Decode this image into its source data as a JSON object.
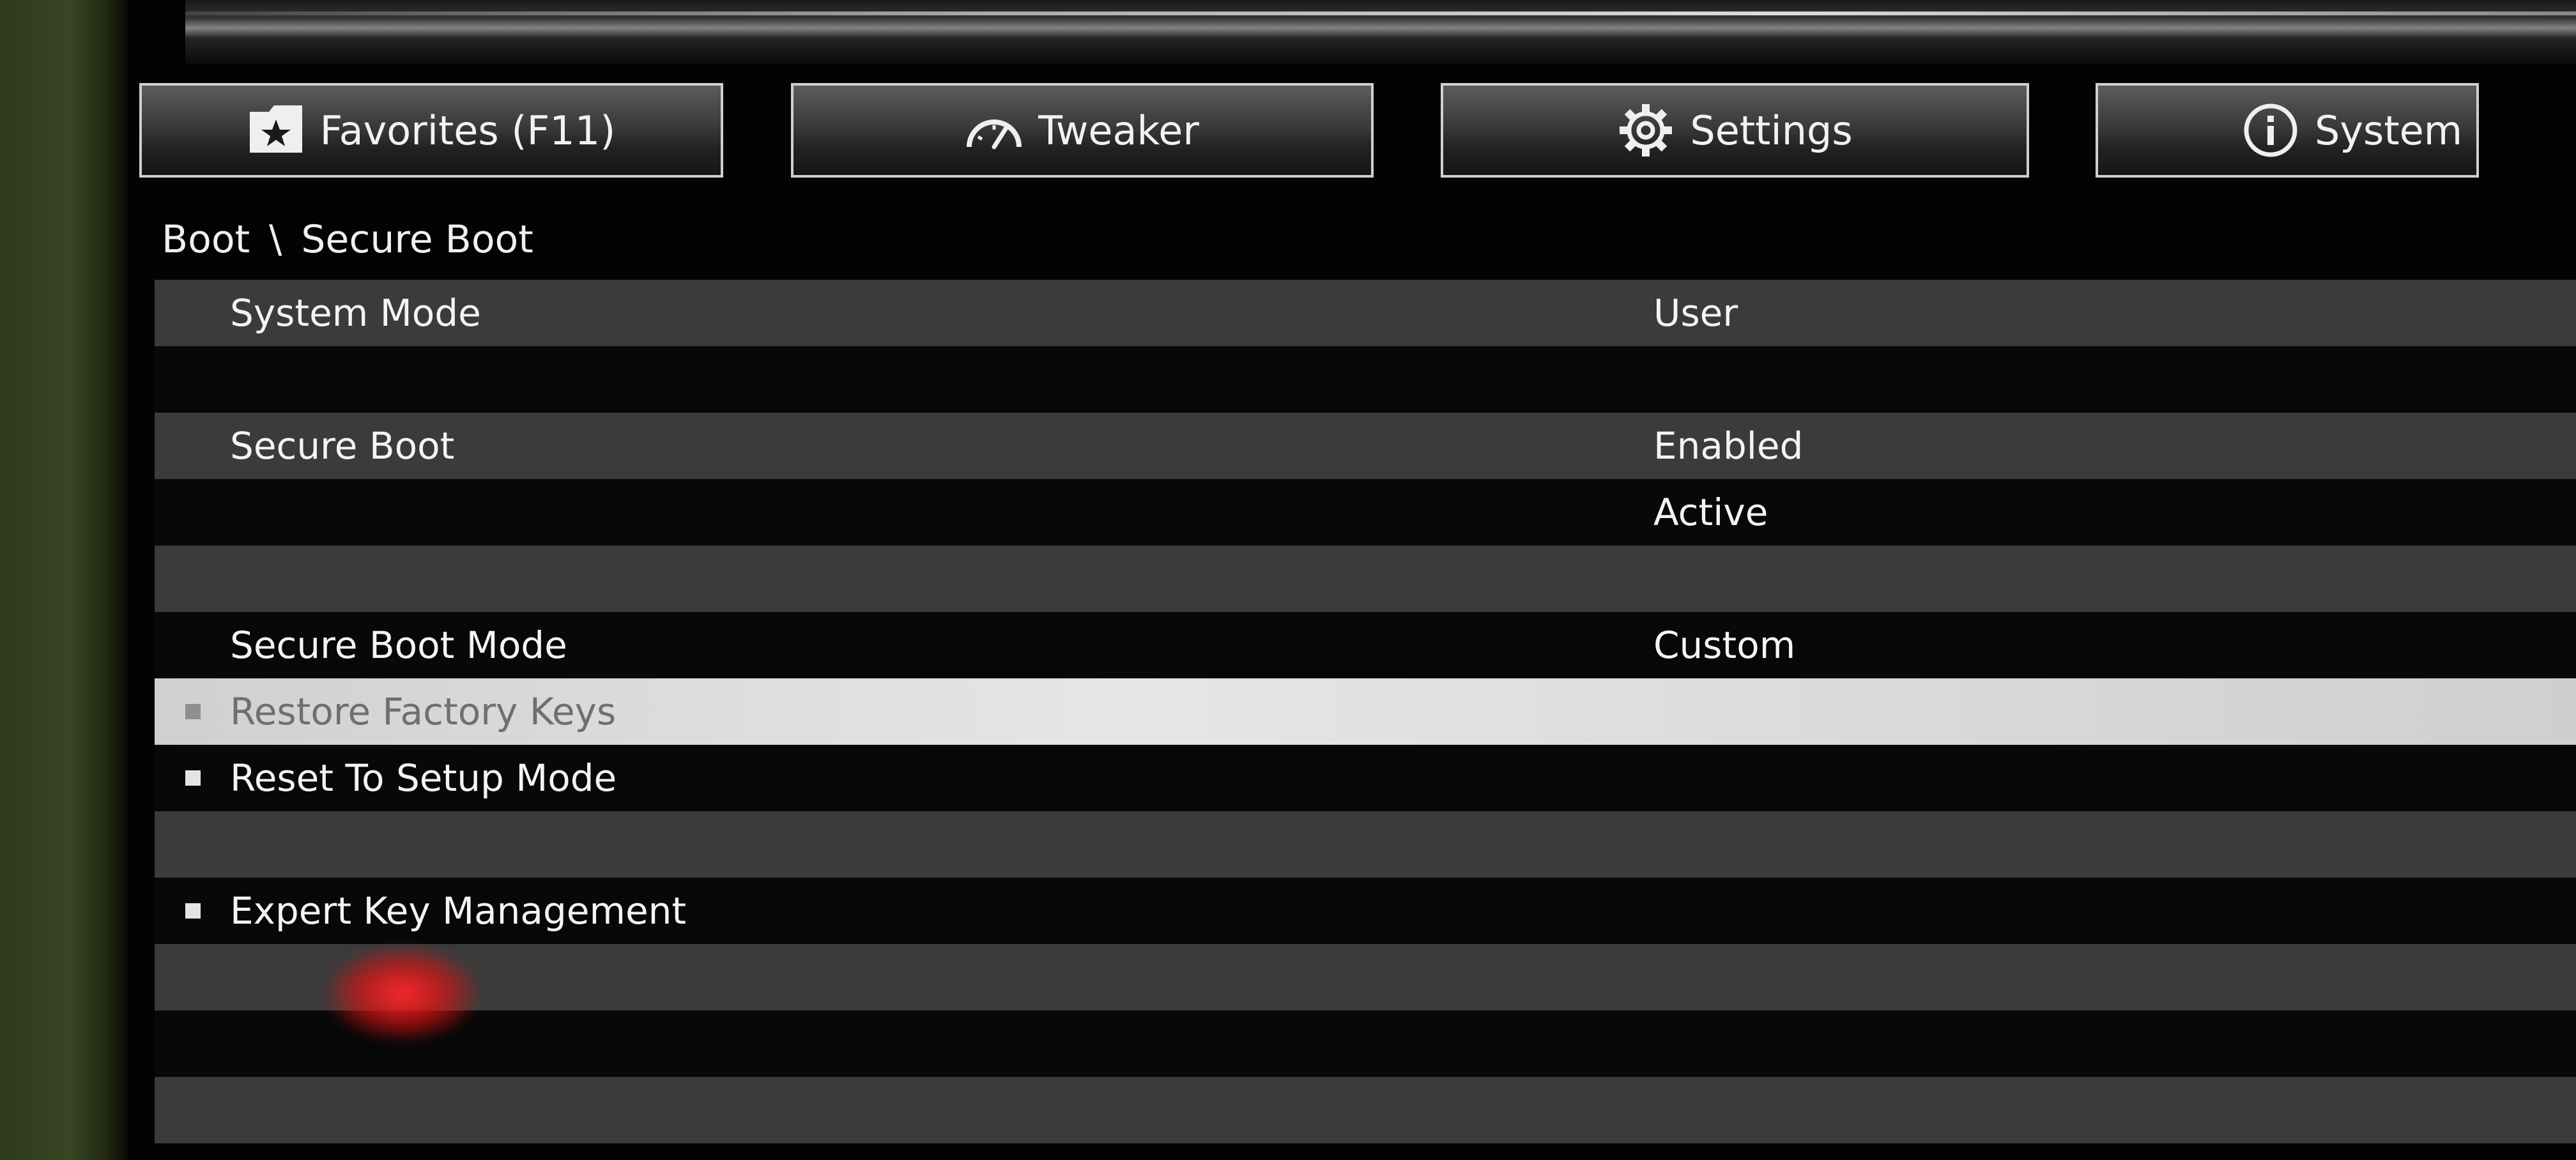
{
  "tabs": [
    {
      "label": "Favorites (F11)",
      "icon": "favorites-folder-star-icon"
    },
    {
      "label": "Tweaker",
      "icon": "speedometer-icon"
    },
    {
      "label": "Settings",
      "icon": "gear-icon"
    },
    {
      "label": "System",
      "icon": "info-icon"
    }
  ],
  "breadcrumb": {
    "parent": "Boot",
    "separator": "\\",
    "current": "Secure Boot"
  },
  "rows": [
    {
      "label": "System Mode",
      "value": "User"
    },
    {
      "label": "",
      "value": ""
    },
    {
      "label": "Secure Boot",
      "value": "Enabled"
    },
    {
      "label": "",
      "value": "Active"
    },
    {
      "label": "",
      "value": ""
    },
    {
      "label": "Secure Boot Mode",
      "value": "Custom"
    },
    {
      "label": "Restore Factory Keys",
      "value": "",
      "selected": true
    },
    {
      "label": "Reset To Setup Mode",
      "value": ""
    },
    {
      "label": "",
      "value": ""
    },
    {
      "label": "Expert Key Management",
      "value": ""
    }
  ],
  "colors": {
    "tab_border": "#cfcfcf",
    "row_light": "#3b3b3b",
    "row_dark": "#080808",
    "selected_row": "#e0e0e0",
    "text": "#f4f4f4",
    "selected_text": "#6f6f6f"
  }
}
